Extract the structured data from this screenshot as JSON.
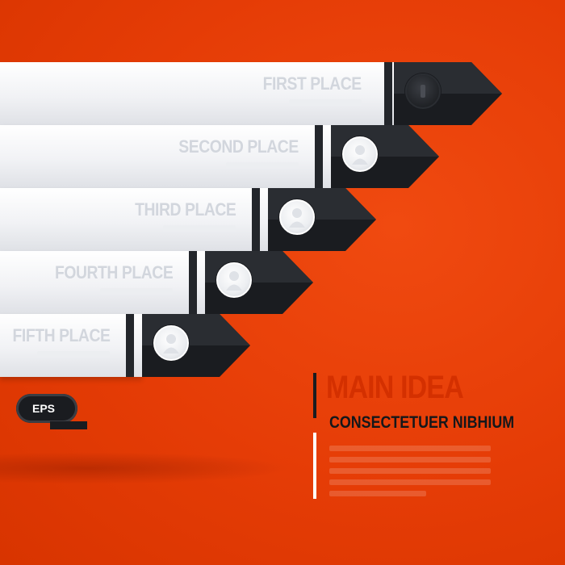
{
  "colors": {
    "background": "#e53c06",
    "bar": "#f1f2f5",
    "tip": "#1a1c20",
    "label": "#d2d6dd",
    "idea_title": "#d43000"
  },
  "places": [
    {
      "label": "FIRST PLACE",
      "icon": "dark-circle-icon"
    },
    {
      "label": "SECOND PLACE",
      "icon": "person-icon"
    },
    {
      "label": "THIRD PLACE",
      "icon": "person-icon"
    },
    {
      "label": "FOURTH PLACE",
      "icon": "person-icon"
    },
    {
      "label": "FIFTH PLACE",
      "icon": "person-icon"
    }
  ],
  "badge": {
    "label": "EPS"
  },
  "main_idea": {
    "title": "MAIN IDEA",
    "subtitle": "CONSECTETUER NIBHIUM"
  }
}
